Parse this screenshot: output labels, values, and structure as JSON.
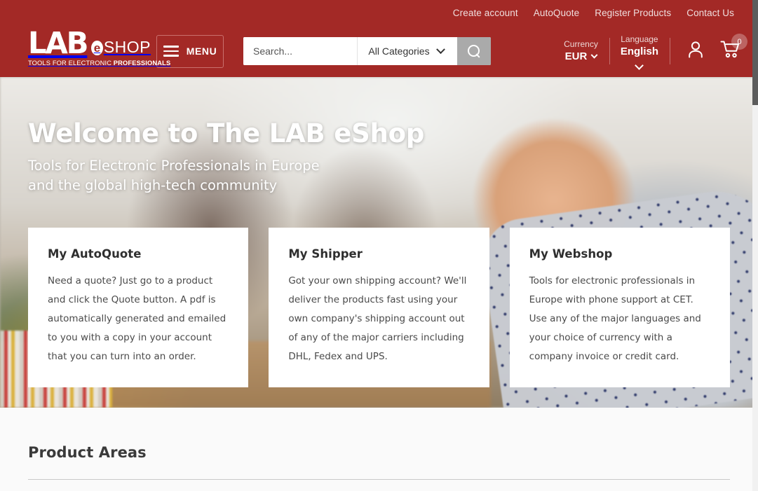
{
  "brand": {
    "logo_lab": "LAB",
    "logo_e": "e",
    "logo_shop": "SHOP",
    "logo_tagline_normal": "TOOLS FOR ELECTRONIC ",
    "logo_tagline_bold": "PROFESSIONALS",
    "accent_color": "#a32926",
    "search_button_color": "#aaaaaa"
  },
  "topbar": {
    "links": [
      {
        "label": "Create account"
      },
      {
        "label": "AutoQuote"
      },
      {
        "label": "Register Products"
      },
      {
        "label": "Contact Us"
      }
    ]
  },
  "header": {
    "menu_label": "MENU",
    "menu_icon": "hamburger-icon",
    "search": {
      "placeholder": "Search...",
      "value": "",
      "category_selected": "All Categories",
      "category_options": [
        "All Categories"
      ],
      "search_icon": "magnifier-icon"
    },
    "currency": {
      "label": "Currency",
      "value": "EUR",
      "chevron_icon": "chevron-down-icon"
    },
    "language": {
      "label": "Language",
      "value": "English",
      "chevron_icon": "chevron-down-icon"
    },
    "account_icon": "user-icon",
    "cart_icon": "shopping-cart-icon",
    "cart_count": "0"
  },
  "hero": {
    "title": "Welcome to The LAB eShop",
    "subtitle_line1": "Tools for Electronic Professionals in Europe",
    "subtitle_line2": "and the global high-tech community",
    "cards": [
      {
        "title": "My AutoQuote",
        "body": "Need a quote? Just go to a product and click the Quote button. A pdf is automatically generated and emailed to you with a copy in your account that you can turn into an order."
      },
      {
        "title": "My Shipper",
        "body": "Got your own shipping account? We'll deliver the products fast using your own company's shipping account out of any of the major carriers including DHL, Fedex and UPS."
      },
      {
        "title": "My Webshop",
        "body": "Tools for electronic professionals in Europe with phone support at CET. Use any of the major  languages and your choice of currency with a company invoice or credit card."
      }
    ]
  },
  "main": {
    "section_title": "Product Areas"
  }
}
